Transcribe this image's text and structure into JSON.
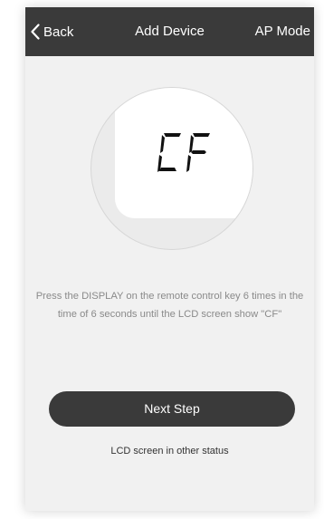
{
  "header": {
    "back_label": "Back",
    "title": "Add Device",
    "right_action": "AP Mode"
  },
  "illustration": {
    "lcd_text": "CF"
  },
  "instruction": {
    "text": "Press the DISPLAY on the remote control key 6 times in the time of 6 seconds until the LCD screen show \"CF\""
  },
  "actions": {
    "next_label": "Next Step",
    "other_status_label": "LCD screen in other status"
  },
  "colors": {
    "navbar": "#3a3a3a",
    "background": "#f1f1f1",
    "button": "#3a3a3a",
    "instruction_text": "#8a8a8a"
  },
  "icons": {
    "back": "chevron-left-icon"
  }
}
